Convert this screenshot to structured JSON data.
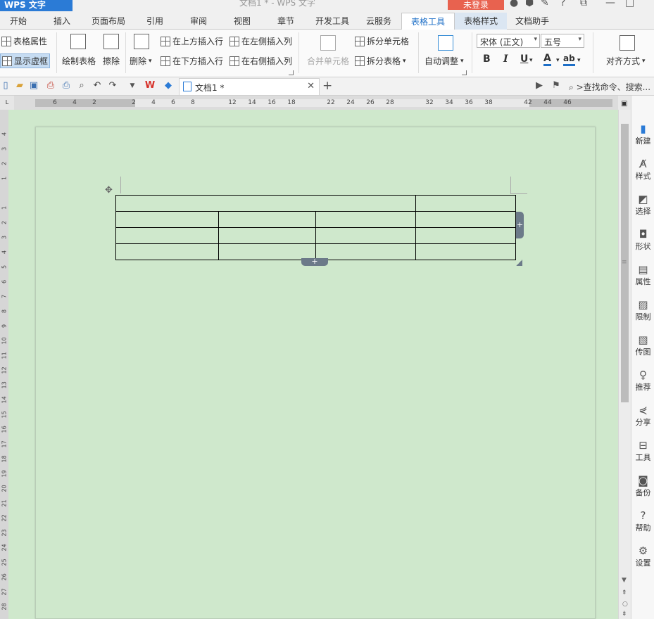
{
  "titlebar": {
    "app_button": "WPS 文字",
    "title": "文档1 * - WPS 文字",
    "login_button": "未登录"
  },
  "tabs": [
    {
      "label": "开始"
    },
    {
      "label": "插入"
    },
    {
      "label": "页面布局"
    },
    {
      "label": "引用"
    },
    {
      "label": "审阅"
    },
    {
      "label": "视图"
    },
    {
      "label": "章节"
    },
    {
      "label": "开发工具"
    },
    {
      "label": "云服务"
    },
    {
      "label": "表格工具",
      "active": true
    },
    {
      "label": "表格样式"
    },
    {
      "label": "文档助手"
    }
  ],
  "ribbon": {
    "table_properties": "表格属性",
    "show_gridlines": "显示虚框",
    "draw_table": "绘制表格",
    "erase": "擦除",
    "delete": "删除",
    "insert_above": "在上方插入行",
    "insert_below": "在下方插入行",
    "insert_left": "在左侧插入列",
    "insert_right": "在右侧插入列",
    "merge_cells": "合并单元格",
    "split_cells": "拆分单元格",
    "split_table": "拆分表格",
    "autofit": "自动调整",
    "font_name": "宋体 (正文)",
    "font_size": "五号",
    "bold": "B",
    "italic": "I",
    "underline": "U",
    "font_color": "A",
    "alignment": "对齐方式"
  },
  "document_tab": {
    "title": "文档1 *",
    "search_placeholder": ">查找命令、搜索..."
  },
  "ruler": {
    "horizontal_ticks": [
      "6",
      "4",
      "2",
      "",
      "2",
      "4",
      "6",
      "8",
      "",
      "12",
      "14",
      "16",
      "18",
      "",
      "22",
      "24",
      "26",
      "28",
      "",
      "32",
      "34",
      "36",
      "38",
      "",
      "42",
      "44",
      "46"
    ],
    "vertical_ticks": [
      "4",
      "3",
      "2",
      "1",
      "",
      "1",
      "2",
      "3",
      "4",
      "5",
      "6",
      "7",
      "8",
      "9",
      "10",
      "11",
      "12",
      "13",
      "14",
      "15",
      "16",
      "17",
      "18",
      "19",
      "20",
      "21",
      "22",
      "23",
      "24",
      "25",
      "26",
      "27",
      "28"
    ]
  },
  "sidebar": [
    {
      "label": "新建",
      "icon": "new-doc-icon"
    },
    {
      "label": "样式",
      "icon": "style-icon"
    },
    {
      "label": "选择",
      "icon": "select-icon"
    },
    {
      "label": "形状",
      "icon": "shape-icon"
    },
    {
      "label": "属性",
      "icon": "properties-icon"
    },
    {
      "label": "限制",
      "icon": "restrict-icon"
    },
    {
      "label": "传图",
      "icon": "upload-image-icon"
    },
    {
      "label": "推荐",
      "icon": "recommend-icon"
    },
    {
      "label": "分享",
      "icon": "share-icon"
    },
    {
      "label": "工具",
      "icon": "toolbox-icon"
    },
    {
      "label": "备份",
      "icon": "backup-icon"
    },
    {
      "label": "帮助",
      "icon": "help-icon"
    },
    {
      "label": "设置",
      "icon": "settings-icon"
    }
  ],
  "colors": {
    "accent": "#1e6fc7",
    "page_background": "#cfe8cc",
    "login_button": "#e8624f",
    "font_color_bar": "#1e6fc7"
  }
}
